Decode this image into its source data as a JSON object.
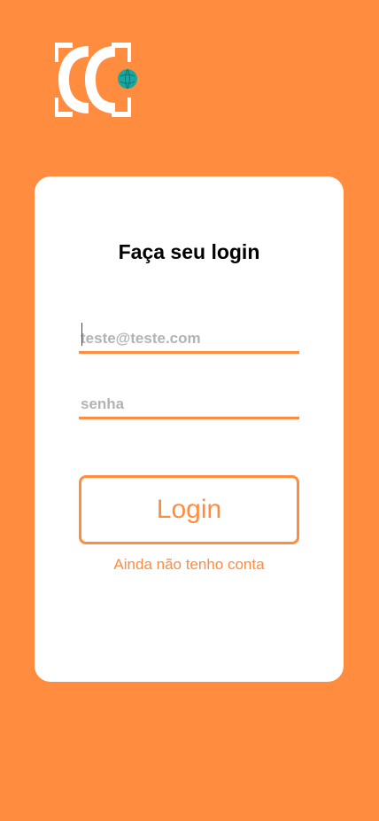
{
  "login": {
    "title": "Faça seu login",
    "email_placeholder": "teste@teste.com",
    "password_placeholder": "senha",
    "login_button": "Login",
    "signup_link": "Ainda não tenho conta"
  },
  "colors": {
    "background": "#ff8c3f",
    "accent": "#ff8c3f",
    "card": "#ffffff",
    "logo_globe": "#1aa7a1"
  },
  "icons": {
    "logo": "cc-monogram-globe-logo"
  }
}
